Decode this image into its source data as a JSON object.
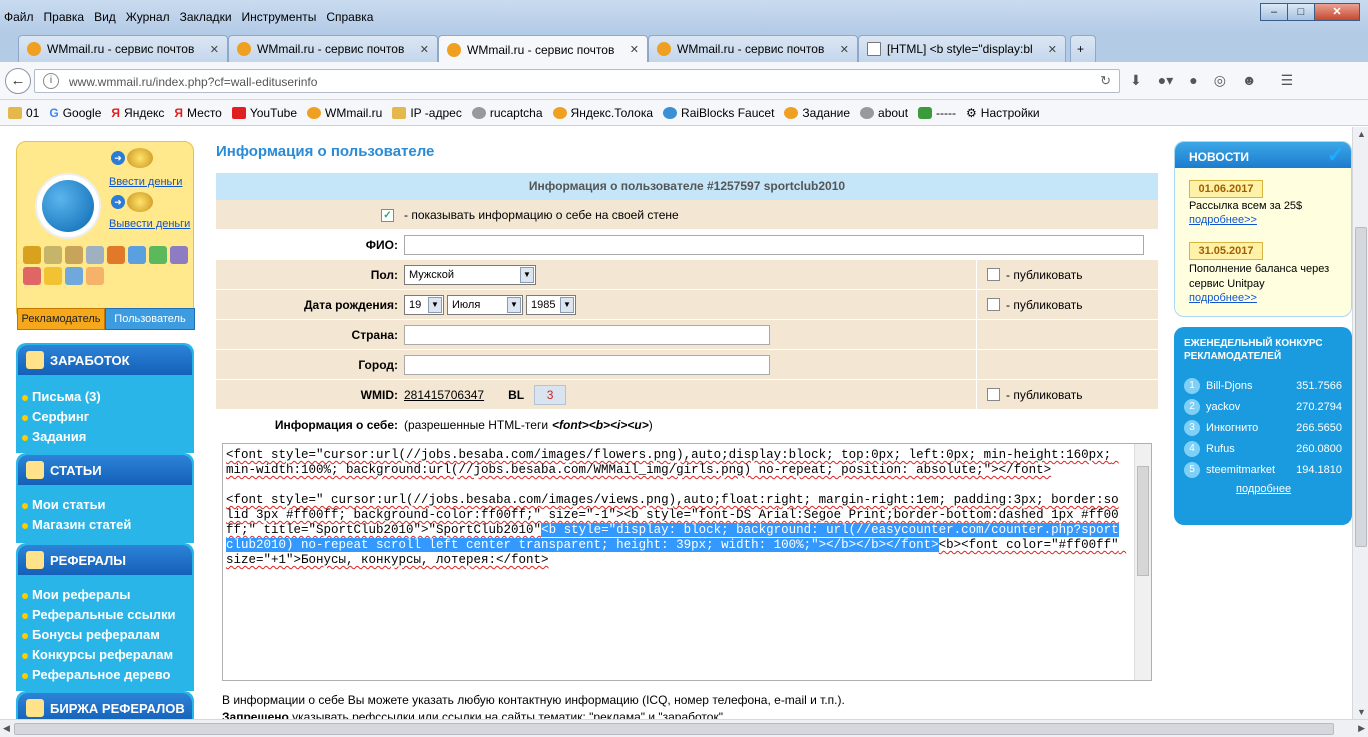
{
  "browser": {
    "menu": [
      "Файл",
      "Правка",
      "Вид",
      "Журнал",
      "Закладки",
      "Инструменты",
      "Справка"
    ],
    "tabs": [
      {
        "label": "WMmail.ru - сервис почтов"
      },
      {
        "label": "WMmail.ru - сервис почтов"
      },
      {
        "label": "WMmail.ru - сервис почтов"
      },
      {
        "label": "WMmail.ru - сервис почтов"
      },
      {
        "label": "[HTML] <b style=\"display:bl"
      }
    ],
    "url": "www.wmmail.ru/index.php?cf=wall-edituserinfo",
    "bookmarks": [
      "01",
      "Google",
      "Яндекс",
      "Место",
      "YouTube",
      "WMmail.ru",
      "IP -адрес",
      "rucaptcha",
      "Яндекс.Толока",
      "RaiBlocks Faucet",
      "Задание",
      "about",
      "-----",
      "Настройки"
    ]
  },
  "usercard": {
    "deposit": "Ввести деньги",
    "withdraw": "Вывести деньги",
    "role_advertiser": "Рекламодатель",
    "role_user": "Пользователь"
  },
  "sidebar": {
    "earnings_title": "ЗАРАБОТОК",
    "earnings_items": [
      "Письма (3)",
      "Серфинг",
      "Задания"
    ],
    "articles_title": "СТАТЬИ",
    "articles_items": [
      "Мои статьи",
      "Магазин статей"
    ],
    "referrals_title": "РЕФЕРАЛЫ",
    "referrals_items": [
      "Мои рефералы",
      "Реферальные ссылки",
      "Бонусы рефералам",
      "Конкурсы рефералам",
      "Реферальное дерево"
    ],
    "exchange_title": "БИРЖА РЕФЕРАЛОВ"
  },
  "main": {
    "page_title": "Информация о пользователе",
    "table_header": "Информация о пользователе #1257597 sportclub2010",
    "show_info": "- показывать информацию о себе на своей стене",
    "fio_label": "ФИО:",
    "sex_label": "Пол:",
    "sex_value": "Мужской",
    "birth_label": "Дата рождения:",
    "birth_day": "19",
    "birth_month": "Июля",
    "birth_year": "1985",
    "country_label": "Страна:",
    "city_label": "Город:",
    "wmid_label": "WMID:",
    "wmid_value": "281415706347",
    "bl_label": "BL",
    "bl_value": "3",
    "publish": "- публиковать",
    "about_label": "Информация о себе:",
    "about_allowed": "(разрешенные HTML-теги",
    "about_tags": "<font><b><i><u>",
    "about_close": ")",
    "note1": "В информации о себе Вы можете указать любую контактную информацию (ICQ, номер телефона, e-mail и т.п.).",
    "note2_bold": "Запрещено",
    "note2_rest": " указывать рефссылки или ссылки на сайты тематик: \"реклама\" и \"заработок\"."
  },
  "editor": {
    "line1": "<font style=\"cursor:url(//jobs.besaba.com/images/flowers.png),auto;display:block; top:0px; left:0px; min-height:160px; min-width:100%; background:url(//jobs.besaba.com/WMMail_img/girls.png) no-repeat; position: absolute;\"></font>",
    "line2a": "<font style=\" cursor:url(//jobs.besaba.com/images/views.png),auto;float:right; margin-right:1em; padding:3px; border:solid 3px #ff00ff; background-color:ff00ff;\" size=\"-1\"><b style=\"font-DS Arial:Segoe Print;border-bottom:dashed 1px #ff00ff;\" title=\"SportClub2010\">\"SportClub2010\"",
    "line2_highlight": "<b style=\"display: block; background: url(//easycounter.com/counter.php?sportclub2010) no-repeat scroll left center transparent; height: 39px; width: 100%;\"></b></b></font>",
    "line2b": "<b><font color=\"#ff00ff\" size=\"+1\">Бонусы, конкурсы, лотерея:</font>"
  },
  "news": {
    "title": "НОВОСТИ",
    "items": [
      {
        "date": "01.06.2017",
        "text": "Рассылка всем за 25$",
        "more": "подробнее>>"
      },
      {
        "date": "31.05.2017",
        "text": "Пополнение баланса через сервис Unitpay",
        "more": "подробнее>>"
      }
    ]
  },
  "contest": {
    "title": "ЕЖЕНЕДЕЛЬНЫЙ КОНКУРС РЕКЛАМОДАТЕЛЕЙ",
    "rows": [
      {
        "n": "1",
        "name": "Bill-Djons",
        "score": "351.7566"
      },
      {
        "n": "2",
        "name": "yackov",
        "score": "270.2794"
      },
      {
        "n": "3",
        "name": "Инкогнито",
        "score": "266.5650"
      },
      {
        "n": "4",
        "name": "Rufus",
        "score": "260.0800"
      },
      {
        "n": "5",
        "name": "steemitmarket",
        "score": "194.1810"
      }
    ],
    "more": "подробнее"
  }
}
